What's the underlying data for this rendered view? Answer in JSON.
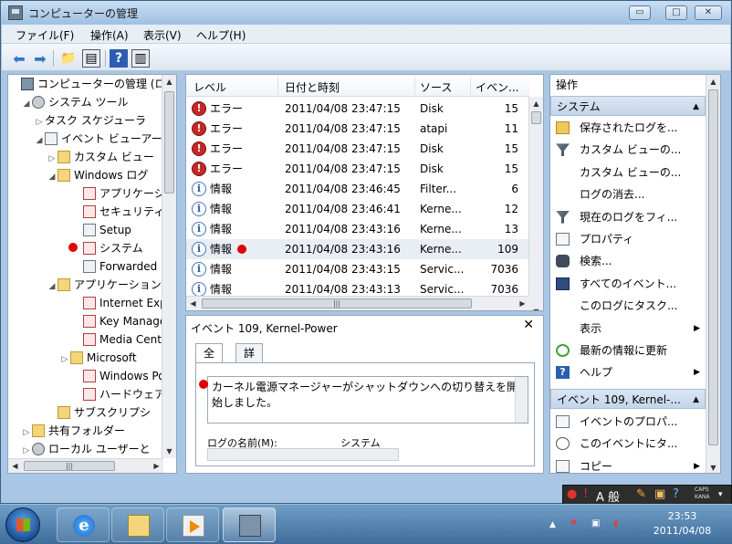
{
  "window": {
    "title": "コンピューターの管理",
    "caption_buttons": {
      "minimize": "▭",
      "maximize": "□",
      "close": "✕"
    }
  },
  "menu": [
    "ファイル(F)",
    "操作(A)",
    "表示(V)",
    "ヘルプ(H)"
  ],
  "toolbar": {
    "icons": [
      "back-arrow-icon",
      "forward-arrow-icon",
      "up-folder-icon",
      "show-hide-tree-icon",
      "help-icon",
      "show-hide-action-icon"
    ]
  },
  "tree": {
    "items": [
      {
        "label": "コンピューターの管理 (ロー",
        "icon": "computer",
        "exp": ""
      },
      {
        "label": "システム ツール",
        "icon": "gear",
        "exp": "◢"
      },
      {
        "label": "タスク スケジューラ",
        "icon": "clock",
        "exp": "▷"
      },
      {
        "label": "イベント ビューアー",
        "icon": "log",
        "exp": "◢"
      },
      {
        "label": "カスタム ビュー",
        "icon": "folder",
        "exp": "▷"
      },
      {
        "label": "Windows ログ",
        "icon": "folder",
        "exp": "◢"
      },
      {
        "label": "アプリケーショ",
        "icon": "logr",
        "exp": ""
      },
      {
        "label": "セキュリティ",
        "icon": "logr",
        "exp": ""
      },
      {
        "label": "Setup",
        "icon": "log",
        "exp": ""
      },
      {
        "label": "システム",
        "icon": "logr",
        "exp": ""
      },
      {
        "label": "Forwarded E",
        "icon": "log",
        "exp": ""
      },
      {
        "label": "アプリケーション",
        "icon": "folder",
        "exp": "◢"
      },
      {
        "label": "Internet Exp",
        "icon": "logr",
        "exp": ""
      },
      {
        "label": "Key Manage",
        "icon": "logr",
        "exp": ""
      },
      {
        "label": "Media Cente",
        "icon": "logr",
        "exp": ""
      },
      {
        "label": "Microsoft",
        "icon": "folder",
        "exp": "▷"
      },
      {
        "label": "Windows Po",
        "icon": "logr",
        "exp": ""
      },
      {
        "label": "ハードウェア",
        "icon": "logr",
        "exp": ""
      },
      {
        "label": "サブスクリプシ",
        "icon": "folder",
        "exp": ""
      },
      {
        "label": "共有フォルダー",
        "icon": "folder",
        "exp": "▷"
      },
      {
        "label": "ローカル ユーザーと",
        "icon": "gear",
        "exp": "▷"
      }
    ]
  },
  "events": {
    "columns": [
      "レベル",
      "日付と時刻",
      "ソース",
      "イベン..."
    ],
    "rows": [
      {
        "level": "エラー",
        "type": "err",
        "datetime": "2011/04/08 23:47:15",
        "source": "Disk",
        "id": "15"
      },
      {
        "level": "エラー",
        "type": "err",
        "datetime": "2011/04/08 23:47:15",
        "source": "atapi",
        "id": "11"
      },
      {
        "level": "エラー",
        "type": "err",
        "datetime": "2011/04/08 23:47:15",
        "source": "Disk",
        "id": "15"
      },
      {
        "level": "エラー",
        "type": "err",
        "datetime": "2011/04/08 23:47:15",
        "source": "Disk",
        "id": "15"
      },
      {
        "level": "情報",
        "type": "info",
        "datetime": "2011/04/08 23:46:45",
        "source": "Filter...",
        "id": "6"
      },
      {
        "level": "情報",
        "type": "info",
        "datetime": "2011/04/08 23:46:41",
        "source": "Kerne...",
        "id": "12"
      },
      {
        "level": "情報",
        "type": "info",
        "datetime": "2011/04/08 23:43:16",
        "source": "Kerne...",
        "id": "13"
      },
      {
        "level": "情報",
        "type": "info",
        "datetime": "2011/04/08 23:43:16",
        "source": "Kerne...",
        "id": "109"
      },
      {
        "level": "情報",
        "type": "info",
        "datetime": "2011/04/08 23:43:15",
        "source": "Servic...",
        "id": "7036"
      },
      {
        "level": "情報",
        "type": "info",
        "datetime": "2011/04/08 23:43:13",
        "source": "Servic...",
        "id": "7036"
      }
    ]
  },
  "detail": {
    "title": "イベント 109, Kernel-Power",
    "close": "✕",
    "tabs": [
      "全般",
      "詳細"
    ],
    "description": "カーネル電源マネージャーがシャットダウンへの切り替えを開始しました。",
    "log_name_label": "ログの名前(M):",
    "log_name_value": "システム"
  },
  "actions": {
    "header": "操作",
    "group1": "システム",
    "items1": [
      {
        "label": "保存されたログを...",
        "icon": "folderopen",
        "sub": ""
      },
      {
        "label": "カスタム ビューの...",
        "icon": "funnel",
        "sub": ""
      },
      {
        "label": "カスタム ビューの...",
        "icon": "",
        "sub": ""
      },
      {
        "label": "ログの消去...",
        "icon": "",
        "sub": ""
      },
      {
        "label": "現在のログをフィ...",
        "icon": "funnel",
        "sub": ""
      },
      {
        "label": "プロパティ",
        "icon": "props",
        "sub": ""
      },
      {
        "label": "検索...",
        "icon": "bino",
        "sub": ""
      },
      {
        "label": "すべてのイベント...",
        "icon": "save",
        "sub": ""
      },
      {
        "label": "このログにタスク...",
        "icon": "",
        "sub": ""
      },
      {
        "label": "表示",
        "icon": "",
        "sub": "▶"
      },
      {
        "label": "最新の情報に更新",
        "icon": "refresh",
        "sub": ""
      },
      {
        "label": "ヘルプ",
        "icon": "help",
        "sub": "▶"
      }
    ],
    "group2": "イベント 109, Kernel-...",
    "items2": [
      {
        "label": "イベントのプロパ...",
        "icon": "props",
        "sub": ""
      },
      {
        "label": "このイベントにタ...",
        "icon": "clock",
        "sub": ""
      },
      {
        "label": "コピー",
        "icon": "copy",
        "sub": "▶"
      }
    ]
  },
  "ime": {
    "text": "A 般",
    "caps": "CAPS",
    "kana": "KANA"
  },
  "taskbar": {
    "time": "23:53",
    "date": "2011/04/08"
  }
}
